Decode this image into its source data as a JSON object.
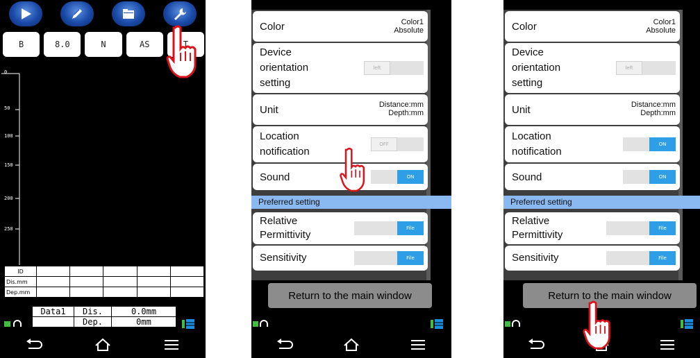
{
  "panel1": {
    "toolbar": {
      "icons": [
        "play-icon",
        "pen-icon",
        "folder-icon",
        "wrench-icon"
      ]
    },
    "params": [
      "B",
      "8.0",
      "N",
      "AS",
      "T"
    ],
    "y_ticks": [
      "0",
      "50",
      "100",
      "150",
      "200",
      "250"
    ],
    "table_rows": [
      "ID",
      "Dis.mm",
      "Dep.mm"
    ],
    "summary": {
      "name": "Data1",
      "dis_label": "Dis.",
      "dis_value": "0.0mm",
      "dep_label": "Dep.",
      "dep_value": "0mm"
    }
  },
  "settings": {
    "color_label": "Color",
    "color_value_1": "Color1",
    "color_value_2": "Absolute",
    "orientation_label_1": "Device",
    "orientation_label_2": "orientation",
    "orientation_label_3": "setting",
    "orientation_toggle": "left",
    "unit_label": "Unit",
    "unit_value_1": "Distance:mm",
    "unit_value_2": "Depth:mm",
    "location_label_1": "Location",
    "location_label_2": "notification",
    "sound_label": "Sound",
    "preferred_header": "Preferred setting",
    "permittivity_label_1": "Relative",
    "permittivity_label_2": "Permittivity",
    "sensitivity_label": "Sensitivity",
    "file_toggle": "File",
    "on_toggle": "ON",
    "off_toggle": "OFF",
    "return_button": "Return to the main window"
  },
  "panel2": {
    "location_state": "OFF",
    "sound_state": "ON"
  },
  "panel3": {
    "location_state": "ON",
    "sound_state": "ON"
  },
  "colors": {
    "accent": "#2e9ee6",
    "pref_bar": "#8ab8f0",
    "hand": "#d9141c",
    "status_green": "#3fbf3f"
  }
}
